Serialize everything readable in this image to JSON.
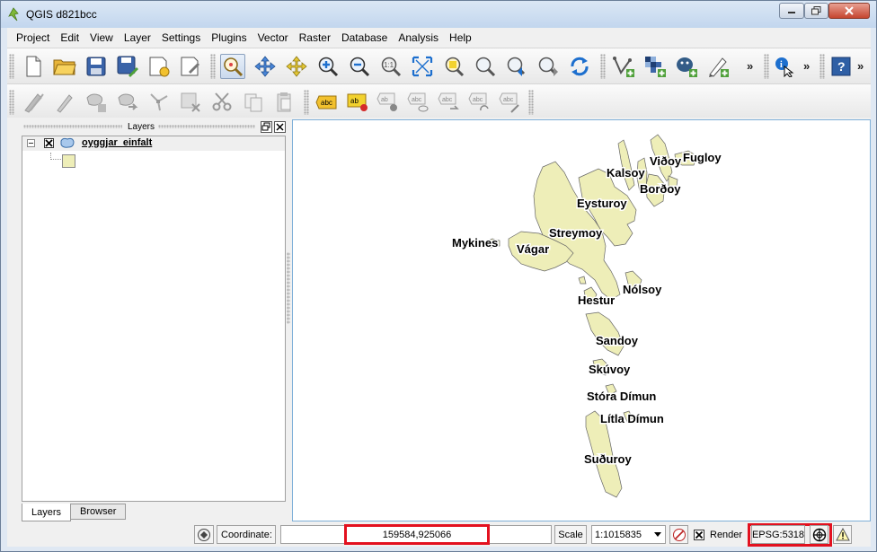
{
  "window": {
    "title": "QGIS d821bcc"
  },
  "menubar": [
    "Project",
    "Edit",
    "View",
    "Layer",
    "Settings",
    "Plugins",
    "Vector",
    "Raster",
    "Database",
    "Analysis",
    "Help"
  ],
  "toolbar_primary_icons": [
    "new-project-icon",
    "open-project-icon",
    "save-project-icon",
    "save-as-icon",
    "new-print-composer-icon",
    "composer-manager-icon",
    "pan-map-icon",
    "pan-to-selection-icon",
    "zoom-in-icon",
    "zoom-out-icon",
    "zoom-native-icon",
    "zoom-full-icon",
    "zoom-to-selection-icon",
    "zoom-to-layer-icon",
    "zoom-last-icon",
    "zoom-next-icon",
    "refresh-icon",
    "add-vector-layer-icon",
    "add-raster-layer-icon",
    "add-postgis-layer-icon",
    "new-shapefile-icon",
    "identify-icon",
    "help-icon"
  ],
  "toolbar_secondary_icons": [
    "toggle-editing-icon",
    "edit-pencil-icon",
    "add-feature-icon",
    "move-feature-icon",
    "node-tool-icon",
    "delete-selected-icon",
    "cut-features-icon",
    "copy-features-icon",
    "paste-features-icon",
    "label-tool-icon",
    "label-highlight-icon",
    "pin-labels-icon",
    "show-hide-labels-icon",
    "move-label-icon",
    "rotate-label-icon",
    "change-label-icon"
  ],
  "overflow": "»",
  "layers_panel": {
    "title": "Layers",
    "layer_name": "oyggjar_einfalt",
    "tabs": [
      "Layers",
      "Browser"
    ]
  },
  "map_labels": [
    {
      "text": "Viðoy"
    },
    {
      "text": "Fugloy"
    },
    {
      "text": "Kalsoy"
    },
    {
      "text": "Borðoy"
    },
    {
      "text": "Eysturoy"
    },
    {
      "text": "Streymoy"
    },
    {
      "text": "Mykines"
    },
    {
      "text": "Vágar"
    },
    {
      "text": "Nólsoy"
    },
    {
      "text": "Hestur"
    },
    {
      "text": "Sandoy"
    },
    {
      "text": "Skúvoy"
    },
    {
      "text": "Stóra Dímun"
    },
    {
      "text": "Lítla Dímun"
    },
    {
      "text": "Suðuroy"
    }
  ],
  "statusbar": {
    "coordinate_label": "Coordinate:",
    "coordinate_value": "159584,925066",
    "scale_label": "Scale",
    "scale_value": "1:1015835",
    "render_label": "Render",
    "crs": "EPSG:5318"
  },
  "colors": {
    "land_fill": "#eeeeb8",
    "highlight": "#e3111f"
  }
}
